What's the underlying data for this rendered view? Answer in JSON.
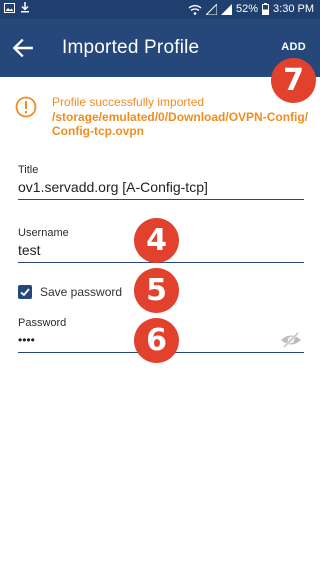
{
  "status_bar": {
    "battery": "52%",
    "time": "3:30 PM"
  },
  "app_bar": {
    "title": "Imported Profile",
    "action": "ADD"
  },
  "notice": {
    "message": "Profile successfully imported",
    "path_line1": "/storage/emulated/0/Download/OVPN-Config/",
    "path_line2": "Config-tcp.ovpn"
  },
  "form": {
    "title_label": "Title",
    "title_value": "ov1.servadd.org [A-Config-tcp]",
    "username_label": "Username",
    "username_value": "test",
    "save_password_label": "Save password",
    "save_password_checked": true,
    "password_label": "Password",
    "password_value": "••••"
  },
  "annotations": [
    "7",
    "4",
    "5",
    "6"
  ],
  "colors": {
    "app_bar": "#26477a",
    "status_bar": "#1f3f6e",
    "notice": "#f28c1e",
    "badge": "#e2412e"
  }
}
